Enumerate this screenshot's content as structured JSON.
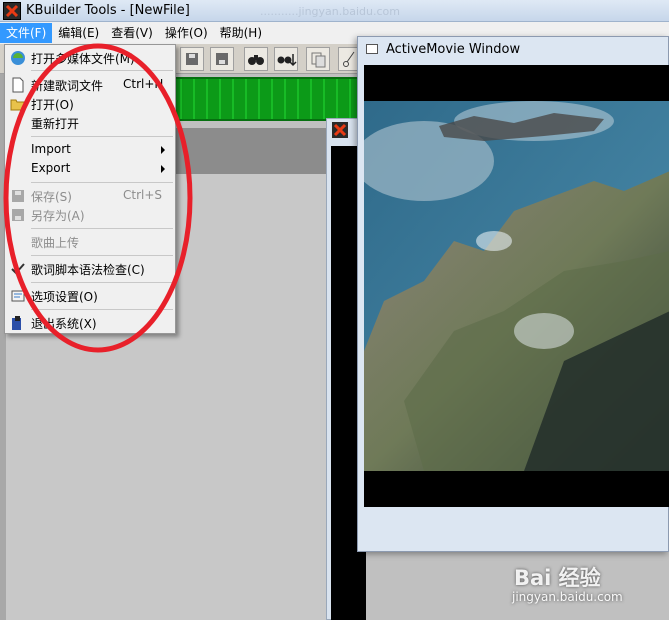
{
  "window": {
    "title": "KBuilder Tools - [NewFile]",
    "ghost_text": "...........jingyan.baidu.com"
  },
  "menubar": {
    "items": [
      "文件(F)",
      "编辑(E)",
      "查看(V)",
      "操作(O)",
      "帮助(H)"
    ]
  },
  "file_menu": {
    "items": [
      {
        "label": "打开多媒体文件(M)",
        "shortcut": "",
        "icon": "media-open-icon"
      },
      {
        "label": "新建歌词文件",
        "shortcut": "Ctrl+N",
        "icon": "new-file-icon"
      },
      {
        "label": "打开(O)",
        "shortcut": "",
        "icon": "folder-open-icon"
      },
      {
        "label": "重新打开",
        "shortcut": "",
        "icon": ""
      },
      {
        "label": "Import",
        "shortcut": "",
        "icon": ""
      },
      {
        "label": "Export",
        "shortcut": "",
        "icon": ""
      },
      {
        "label": "保存(S)",
        "shortcut": "Ctrl+S",
        "icon": "save-icon"
      },
      {
        "label": "另存为(A)",
        "shortcut": "",
        "icon": "save-as-icon"
      },
      {
        "label": "歌曲上传",
        "shortcut": "",
        "icon": ""
      },
      {
        "label": "歌词脚本语法检查(C)",
        "shortcut": "",
        "icon": "syntax-check-icon"
      },
      {
        "label": "选项设置(O)",
        "shortcut": "",
        "icon": "options-icon"
      },
      {
        "label": "退出系统(X)",
        "shortcut": "",
        "icon": "exit-icon"
      }
    ]
  },
  "activemovie": {
    "title": "ActiveMovie Window"
  },
  "watermark": {
    "brand": "Bai 经验",
    "url": "jingyan.baidu.com"
  },
  "colors": {
    "menu_highlight": "#3399ff",
    "annotation": "#e8202a",
    "band_green": "#0c9a18"
  }
}
